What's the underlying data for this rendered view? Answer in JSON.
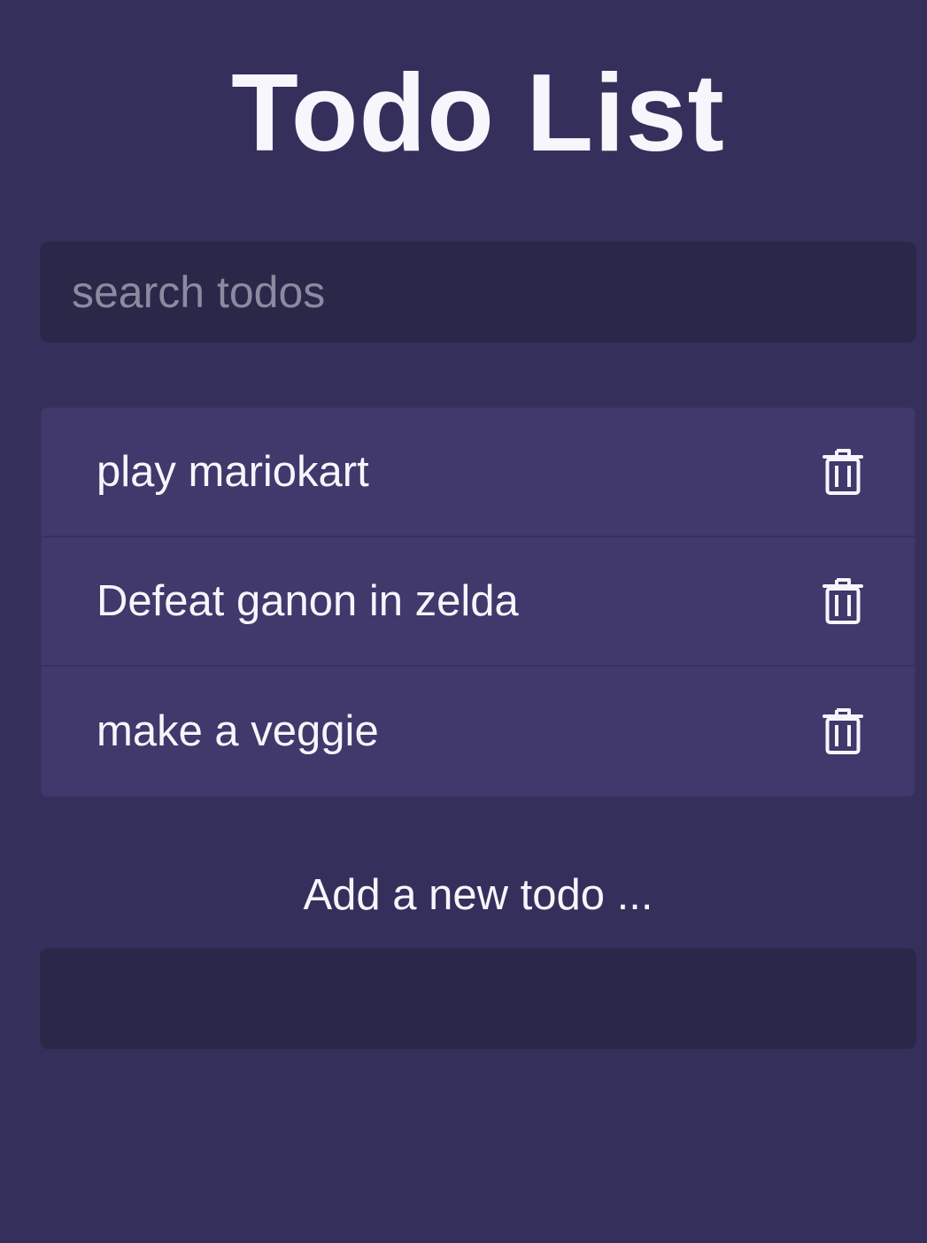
{
  "header": {
    "title": "Todo List"
  },
  "search": {
    "placeholder": "search todos",
    "value": ""
  },
  "todos": [
    {
      "text": "play mariokart",
      "icon": "trash-icon"
    },
    {
      "text": "Defeat ganon in zelda",
      "icon": "trash-icon"
    },
    {
      "text": "make a veggie",
      "icon": "trash-icon"
    }
  ],
  "add_todo": {
    "label": "Add a new todo ...",
    "value": ""
  },
  "colors": {
    "background": "#352f5b",
    "input_background": "#2b2749",
    "list_background": "#41386b",
    "text": "#f6f5fc",
    "placeholder": "#8b8aa0"
  }
}
